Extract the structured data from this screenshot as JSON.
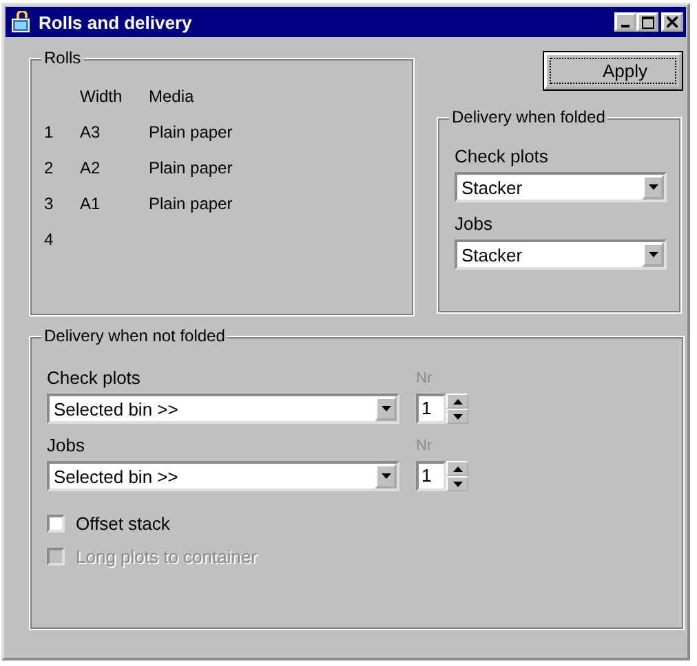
{
  "window": {
    "title": "Rolls and delivery"
  },
  "rolls": {
    "title": "Rolls",
    "columns": [
      "Width",
      "Media"
    ],
    "rows": [
      {
        "number": "1",
        "width": "A3",
        "media": "Plain paper"
      },
      {
        "number": "2",
        "width": "A2",
        "media": "Plain paper"
      },
      {
        "number": "3",
        "width": "A1",
        "media": "Plain paper"
      },
      {
        "number": "4"
      }
    ]
  },
  "apply_button": {
    "label": "Apply",
    "focused": true
  },
  "delivery_folded": {
    "title": "Delivery when folded",
    "fields": [
      {
        "label": "Check plots",
        "value": "Stacker"
      },
      {
        "label": "Jobs",
        "value": "Stacker"
      }
    ]
  },
  "delivery_not_folded": {
    "title": "Delivery when not folded",
    "fields": [
      {
        "label": "Check plots",
        "value": "Selected bin >>",
        "count_label": "Nr",
        "count": "1"
      },
      {
        "label": "Jobs",
        "value": "Selected bin >>",
        "count_label": "Nr",
        "count": "1"
      }
    ],
    "checkboxes": [
      {
        "label": "Offset stack",
        "checked": false,
        "disabled": false
      },
      {
        "label": "Long plots to container",
        "checked": false,
        "disabled": true
      }
    ]
  }
}
